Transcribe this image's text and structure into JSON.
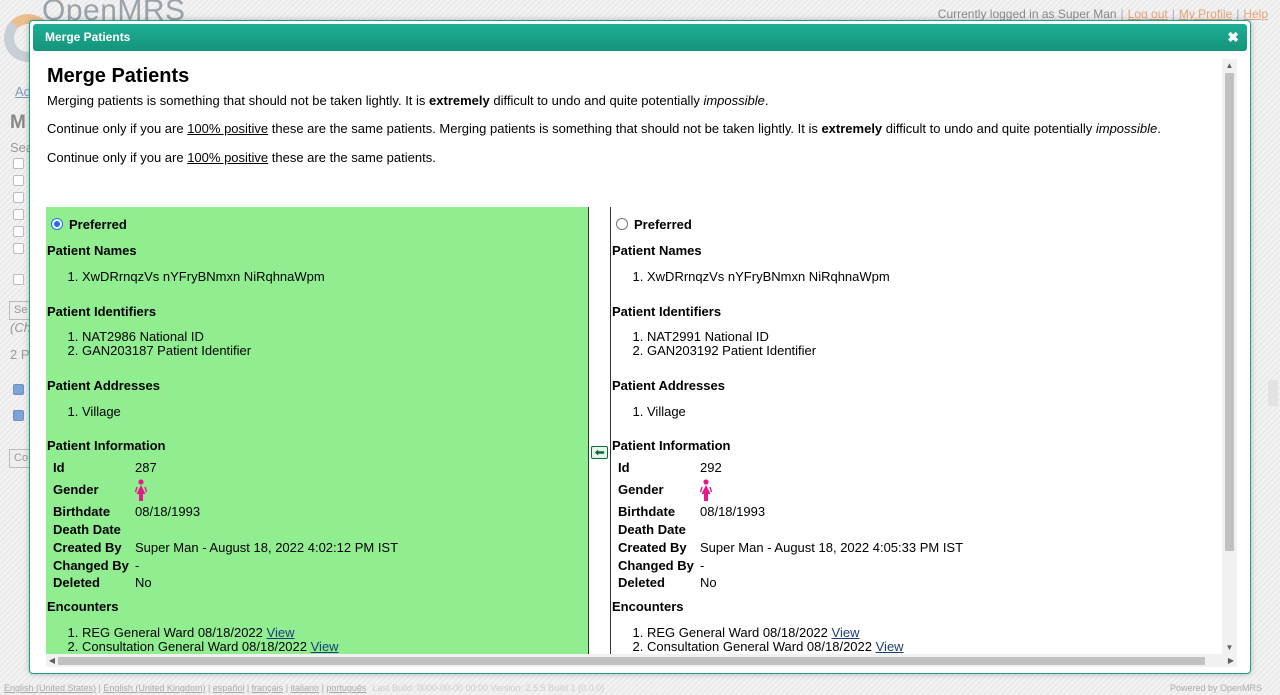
{
  "background": {
    "logo_text": "OpenMRS",
    "userbar": {
      "logged_in": "Currently logged in as Super Man",
      "logout": "Log out",
      "profile": "My Profile",
      "help": "Help"
    },
    "left_letters": {
      "ad": "Ad",
      "m": "M",
      "sea": "Sea",
      "se": "Se",
      "ch": "(Ch",
      "two_p": "2 P",
      "co": "Co"
    },
    "footer_languages": [
      "English (United States)",
      "English (United Kingdom)",
      "español",
      "français",
      "italiano",
      "português"
    ],
    "footer_faint": "Last Build: 0000-00-00 00:00   Version: 2.5.5 Build 1 (0.0.0)",
    "powered": "Powered by OpenMRS"
  },
  "dialog": {
    "title": "Merge Patients",
    "close_glyph": "✖",
    "heading": "Merge Patients",
    "warning_a": {
      "p1": "Merging patients is something that should not be taken lightly. It is ",
      "b": "extremely",
      "p2": " difficult to undo and quite potentially ",
      "i": "impossible",
      "p3": "."
    },
    "warning_b": {
      "p1": "Continue only if you are ",
      "u": "100% positive",
      "p2": " these are the same patients. Merging patients is something that should not be taken lightly. It is ",
      "b": "extremely",
      "p3": " difficult to undo and quite potentially ",
      "i": "impossible",
      "p4": "."
    },
    "warning_c": {
      "p1": "Continue only if you are ",
      "u": "100% positive",
      "p2": " these are the same patients."
    },
    "labels": {
      "preferred": "Preferred",
      "names": "Patient Names",
      "identifiers": "Patient Identifiers",
      "addresses": "Patient Addresses",
      "info": "Patient Information",
      "encounters": "Encounters",
      "id": "Id",
      "gender": "Gender",
      "birthdate": "Birthdate",
      "death_date": "Death Date",
      "created_by": "Created By",
      "changed_by": "Changed By",
      "deleted": "Deleted",
      "view": "View"
    },
    "patients": [
      {
        "preferred": true,
        "name": "XwDRrnqzVs nYFryBNmxn NiRqhnaWpm",
        "identifiers": [
          "NAT2986 National ID",
          "GAN203187 Patient Identifier"
        ],
        "address": "Village",
        "id": "287",
        "gender": "female",
        "birthdate": "08/18/1993",
        "death_date": "",
        "created_by": "Super Man - August 18, 2022 4:02:12 PM IST",
        "changed_by": "-",
        "deleted": "No",
        "encounters": [
          "REG General Ward 08/18/2022",
          "Consultation General Ward 08/18/2022"
        ]
      },
      {
        "preferred": false,
        "name": "XwDRrnqzVs nYFryBNmxn NiRqhnaWpm",
        "identifiers": [
          "NAT2991 National ID",
          "GAN203192 Patient Identifier"
        ],
        "address": "Village",
        "id": "292",
        "gender": "female",
        "birthdate": "08/18/1993",
        "death_date": "",
        "created_by": "Super Man - August 18, 2022 4:05:33 PM IST",
        "changed_by": "-",
        "deleted": "No",
        "encounters": [
          "REG General Ward 08/18/2022",
          "Consultation General Ward 08/18/2022"
        ]
      }
    ],
    "colors": {
      "titlebar": "#14947b",
      "preferred_bg": "#90ee90",
      "female_icon": "#e6198a",
      "link": "#1b3c7a"
    }
  }
}
